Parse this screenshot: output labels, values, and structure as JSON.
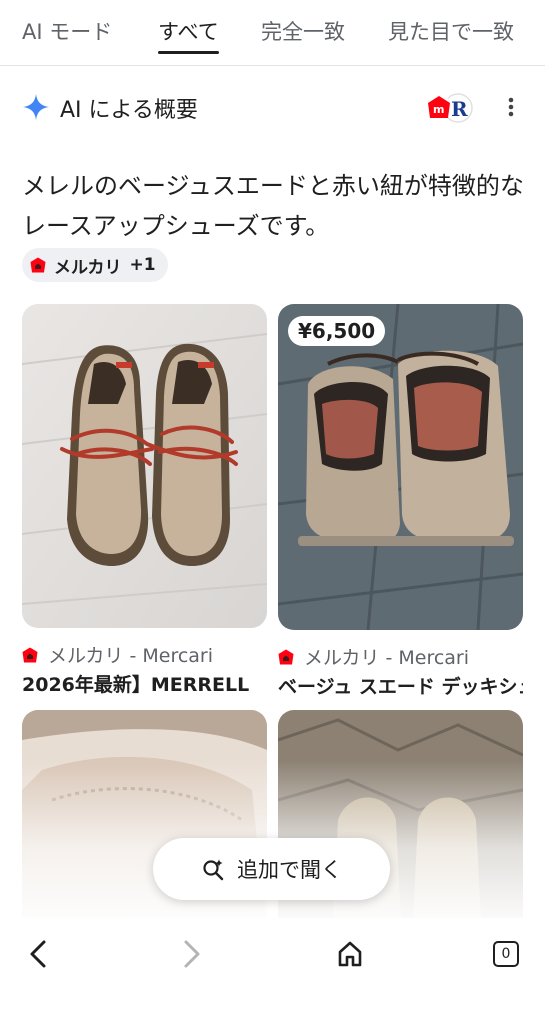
{
  "tabs": [
    {
      "label": "AI モード"
    },
    {
      "label": "すべて",
      "active": true
    },
    {
      "label": "完全一致"
    },
    {
      "label": "見た目で一致"
    }
  ],
  "overview": {
    "title": "AI による概要",
    "summary": "メレルのベージュスエードと赤い紐が特徴的なレースアップシューズです。",
    "source_chip": {
      "label": "メルカリ",
      "extra": "+1"
    }
  },
  "results": [
    {
      "source": "メルカリ - Mercari",
      "title": "2026年最新】MERRELL",
      "price": ""
    },
    {
      "source": "メルカリ - Mercari",
      "title": "ベージュ スエード デッキシューズ",
      "price": "¥6,500"
    },
    {
      "source": "",
      "title": "",
      "price": ""
    },
    {
      "source": "",
      "title": "",
      "price": ""
    }
  ],
  "followup": {
    "label": "追加で聞く"
  },
  "bottom_nav": {
    "tab_count": "0"
  },
  "colors": {
    "accent_blue": "#4285f4",
    "mercari_red": "#ff0211",
    "chip_bg": "#eef0f3"
  }
}
